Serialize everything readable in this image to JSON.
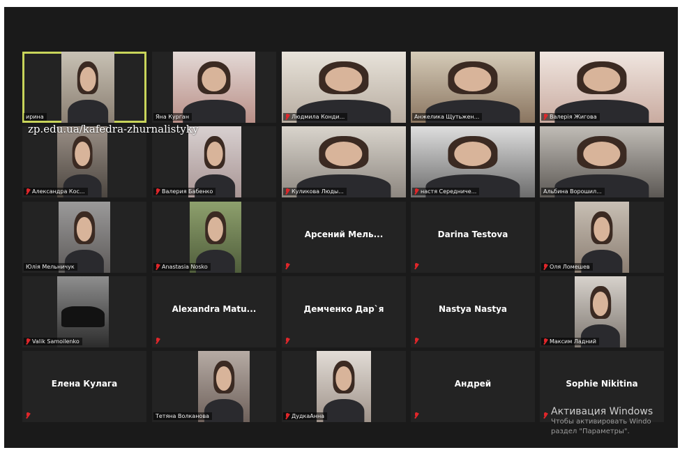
{
  "watermark": "zp.edu.ua/kafedra-zhurnalistyky",
  "windows_activation": {
    "title": "Активация Windows",
    "line1": "Чтобы активировать Windo",
    "line2": "раздел \"Параметры\"."
  },
  "participants": [
    {
      "name": "ирина",
      "video": true,
      "muted": false,
      "active": true
    },
    {
      "name": "Яна Курган",
      "video": true,
      "muted": false
    },
    {
      "name": "Людмила Конди...",
      "video": true,
      "muted": true
    },
    {
      "name": "Анжелика Щутьжен...",
      "video": true,
      "muted": false
    },
    {
      "name": "Валерія Жигова",
      "video": true,
      "muted": true
    },
    {
      "name": "Александра Кос...",
      "video": true,
      "muted": true
    },
    {
      "name": "Валерия Бабенко",
      "video": true,
      "muted": true
    },
    {
      "name": "Куликова Люды...",
      "video": true,
      "muted": true
    },
    {
      "name": "настя Середниче...",
      "video": true,
      "muted": true
    },
    {
      "name": "Альбина Ворошил...",
      "video": true,
      "muted": false
    },
    {
      "name": "Юлія Мельничук",
      "video": true,
      "muted": false
    },
    {
      "name": "Anastasia Nosko",
      "video": true,
      "muted": true
    },
    {
      "name": "Арсений Мель...",
      "video": false,
      "muted": true
    },
    {
      "name": "Darina Testova",
      "video": false,
      "muted": true
    },
    {
      "name": "Оля Ломешев",
      "video": true,
      "muted": true
    },
    {
      "name": "Valik Samoilenko",
      "video": true,
      "muted": true
    },
    {
      "name": "Alexandra Matu...",
      "video": false,
      "muted": true
    },
    {
      "name": "Демченко Дар`я",
      "video": false,
      "muted": true
    },
    {
      "name": "Nastya Nastya",
      "video": false,
      "muted": true
    },
    {
      "name": "Максим Ладний",
      "video": true,
      "muted": true
    },
    {
      "name": "Елена Кулага",
      "video": false,
      "muted": true
    },
    {
      "name": "Тетяна Волканова",
      "video": true,
      "muted": false
    },
    {
      "name": "ДудкаАнна",
      "video": true,
      "muted": true
    },
    {
      "name": "Андрей",
      "video": false,
      "muted": true
    },
    {
      "name": "Sophie Nikitina",
      "video": false,
      "muted": true
    }
  ]
}
